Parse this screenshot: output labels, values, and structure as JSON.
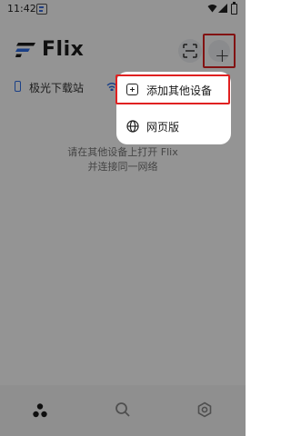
{
  "status_bar": {
    "time": "11:42"
  },
  "header": {
    "app_title": "Flix"
  },
  "device": {
    "name": "极光下载站"
  },
  "empty_state": {
    "line1": "请在其他设备上打开 Flix",
    "line2": "并连接同一网络"
  },
  "popup_menu": {
    "items": [
      {
        "label": "添加其他设备",
        "icon": "add-square-icon"
      },
      {
        "label": "网页版",
        "icon": "globe-icon"
      }
    ]
  },
  "bottom_nav": {
    "items": [
      "devices-icon",
      "search-icon",
      "settings-icon"
    ]
  },
  "colors": {
    "accent": "#2f6fe8",
    "highlight": "#e02020"
  }
}
